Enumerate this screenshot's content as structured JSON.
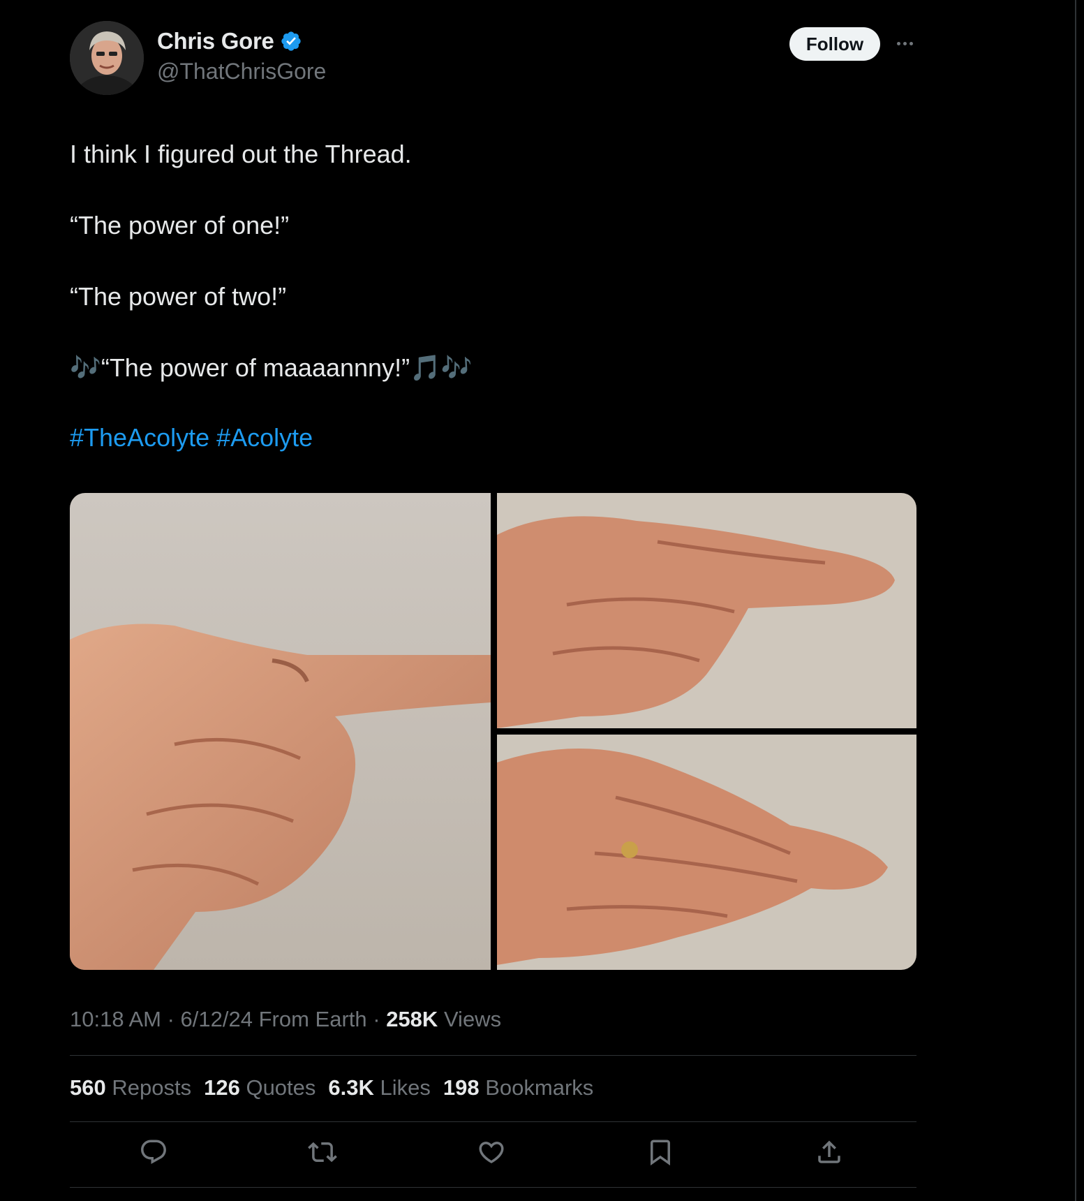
{
  "author": {
    "name": "Chris Gore",
    "handle": "@ThatChrisGore",
    "verified": true,
    "verified_color": "#1d9bf0"
  },
  "header": {
    "follow_label": "Follow"
  },
  "tweet": {
    "lines": [
      "I think I figured out the Thread.",
      "“The power of one!”",
      "“The power of two!”",
      "🎶“The power of maaaannny!”🎵🎶"
    ],
    "hashtags": [
      "#TheAcolyte",
      "#Acolyte"
    ],
    "hashtag_color": "#1d9bf0"
  },
  "media": {
    "count": 3
  },
  "meta": {
    "time": "10:18 AM",
    "date": "6/12/24",
    "location": "From Earth",
    "views_count": "258K",
    "views_label": "Views"
  },
  "stats": {
    "reposts_count": "560",
    "reposts_label": "Reposts",
    "quotes_count": "126",
    "quotes_label": "Quotes",
    "likes_count": "6.3K",
    "likes_label": "Likes",
    "bookmarks_count": "198",
    "bookmarks_label": "Bookmarks"
  },
  "actions": [
    "reply-icon",
    "repost-icon",
    "like-icon",
    "bookmark-icon",
    "share-icon"
  ]
}
